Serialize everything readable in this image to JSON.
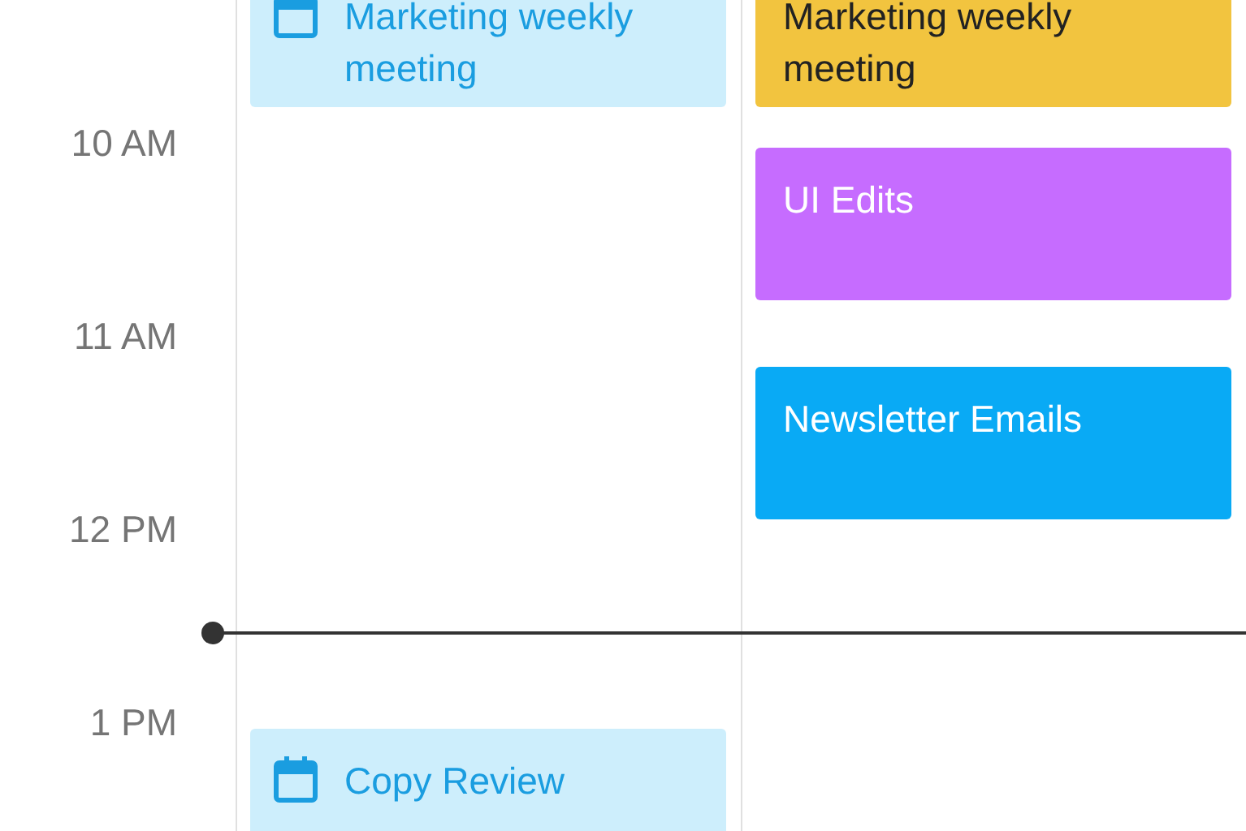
{
  "time_labels": [
    "10 AM",
    "11 AM",
    "12 PM",
    "1 PM"
  ],
  "columns": [
    {
      "events": [
        {
          "title": "Marketing weekly meeting",
          "kind": "light",
          "color": "#cdeefc"
        },
        {
          "title": "Copy Review",
          "kind": "light",
          "color": "#cdeefc"
        }
      ]
    },
    {
      "events": [
        {
          "title": "Marketing weekly meeting",
          "kind": "solid",
          "color": "#f2c43f"
        },
        {
          "title": "UI Edits",
          "kind": "solid",
          "color": "#c66cff"
        },
        {
          "title": "Newsletter Emails",
          "kind": "solid",
          "color": "#09aaf5"
        }
      ]
    }
  ]
}
